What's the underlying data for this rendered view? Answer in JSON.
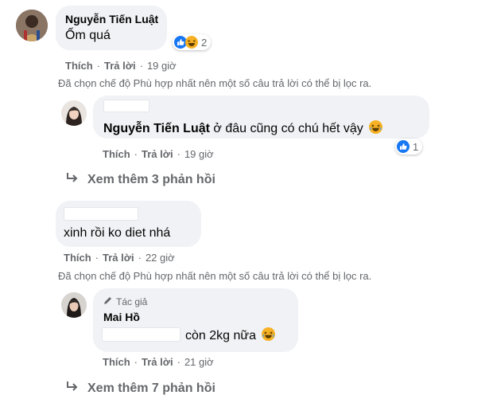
{
  "comment1": {
    "author": "Nguyễn Tiến Luật",
    "text": "Ốm quá",
    "reaction_count": "2",
    "like": "Thích",
    "reply": "Trả lời",
    "time": "19 giờ"
  },
  "filter_note_1": "Đã chọn chế độ Phù hợp nhất nên một số câu trả lời có thể bị lọc ra.",
  "reply1": {
    "mention": "Nguyễn Tiến Luật",
    "text": " ở đâu cũng có chú hết vậy",
    "reaction_count": "1",
    "like": "Thích",
    "reply": "Trả lời",
    "time": "19 giờ"
  },
  "more1": "Xem thêm 3 phản hồi",
  "comment2": {
    "text": "xinh rồi ko diet nhá",
    "like": "Thích",
    "reply": "Trả lời",
    "time": "22 giờ"
  },
  "filter_note_2": "Đã chọn chế độ Phù hợp nhất nên một số câu trả lời có thể bị lọc ra.",
  "reply2": {
    "author_tag": "Tác giả",
    "author": "Mai Hồ",
    "text": "còn 2kg nữa",
    "like": "Thích",
    "reply": "Trả lời",
    "time": "21 giờ"
  },
  "more2": "Xem thêm 7 phản hồi",
  "colors": {
    "bubble": "#f0f2f5",
    "secondary_text": "#65676b",
    "like_blue": "#1877f2",
    "haha_yellow": "#f7b125"
  }
}
